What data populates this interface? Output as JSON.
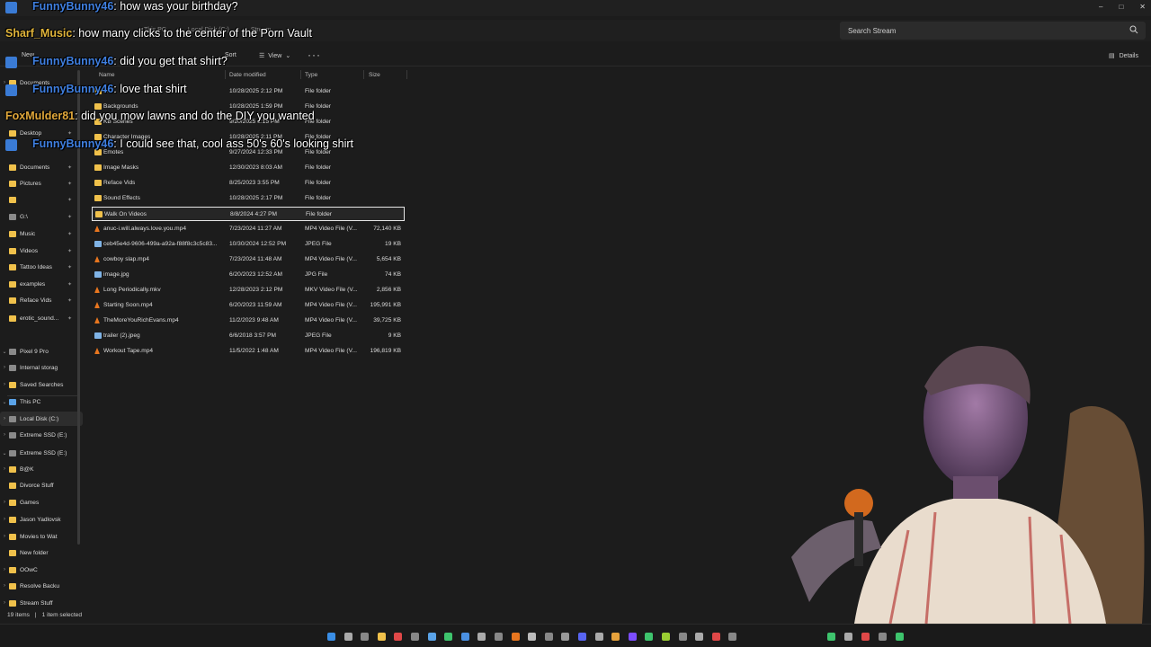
{
  "window": {
    "controls": [
      "–",
      "□",
      "✕"
    ]
  },
  "address": {
    "crumbs": [
      "This PC",
      "Local Disk (C:)",
      "Stream"
    ]
  },
  "search": {
    "placeholder": "Search Stream"
  },
  "toolbar": {
    "new_label": "New",
    "sort_label": "Sort",
    "view_label": "View",
    "more_label": "···",
    "details_label": "Details"
  },
  "columns": {
    "name": "Name",
    "date": "Date modified",
    "type": "Type",
    "size": "Size"
  },
  "files": [
    {
      "name": "...",
      "date": "10/28/2025 2:12 PM",
      "type": "File folder",
      "size": "",
      "kind": "folder"
    },
    {
      "name": "Backgrounds",
      "date": "10/28/2025 1:59 PM",
      "type": "File folder",
      "size": "",
      "kind": "folder"
    },
    {
      "name": "KB Scenes",
      "date": "9/20/2025 1:15 PM",
      "type": "File folder",
      "size": "",
      "kind": "folder"
    },
    {
      "name": "Character Images",
      "date": "10/28/2025 2:11 PM",
      "type": "File folder",
      "size": "",
      "kind": "folder"
    },
    {
      "name": "Emotes",
      "date": "9/27/2024 12:33 PM",
      "type": "File folder",
      "size": "",
      "kind": "folder"
    },
    {
      "name": "Image Masks",
      "date": "12/30/2023 8:03 AM",
      "type": "File folder",
      "size": "",
      "kind": "folder"
    },
    {
      "name": "Reface Vids",
      "date": "8/25/2023 3:55 PM",
      "type": "File folder",
      "size": "",
      "kind": "folder"
    },
    {
      "name": "Sound Effects",
      "date": "10/28/2025 2:17 PM",
      "type": "File folder",
      "size": "",
      "kind": "folder"
    },
    {
      "name": "Walk On Videos",
      "date": "8/8/2024 4:27 PM",
      "type": "File folder",
      "size": "",
      "kind": "folder"
    },
    {
      "name": "anuc-i.will.always.love.you.mp4",
      "date": "7/23/2024 11:27 AM",
      "type": "MP4 Video File (V...",
      "size": "72,140 KB",
      "kind": "video"
    },
    {
      "name": "ceb45e4d-9606-499a-a92a-f88f8c3c5c83...",
      "date": "10/30/2024 12:52 PM",
      "type": "JPEG File",
      "size": "19 KB",
      "kind": "image"
    },
    {
      "name": "cowboy slap.mp4",
      "date": "7/23/2024 11:48 AM",
      "type": "MP4 Video File (V...",
      "size": "5,654 KB",
      "kind": "video"
    },
    {
      "name": "image.jpg",
      "date": "6/20/2023 12:52 AM",
      "type": "JPG File",
      "size": "74 KB",
      "kind": "image"
    },
    {
      "name": "Long Periodically.mkv",
      "date": "12/28/2023 2:12 PM",
      "type": "MKV Video File (V...",
      "size": "2,856 KB",
      "kind": "video"
    },
    {
      "name": "Starting Soon.mp4",
      "date": "6/20/2023 11:59 AM",
      "type": "MP4 Video File (V...",
      "size": "195,991 KB",
      "kind": "video"
    },
    {
      "name": "TheMoreYouRichEvans.mp4",
      "date": "11/2/2023 9:48 AM",
      "type": "MP4 Video File (V...",
      "size": "39,725 KB",
      "kind": "video"
    },
    {
      "name": "trailer (2).jpeg",
      "date": "6/6/2018 3:57 PM",
      "type": "JPEG File",
      "size": "9 KB",
      "kind": "image"
    },
    {
      "name": "Workout Tape.mp4",
      "date": "11/5/2022 1:48 AM",
      "type": "MP4 Video File (V...",
      "size": "196,819 KB",
      "kind": "video"
    }
  ],
  "nav": [
    {
      "label": "Documents",
      "icon": "folder",
      "pinned": false,
      "chev": "›"
    },
    {
      "label": "Desktop",
      "icon": "folder",
      "pinned": true,
      "chev": ""
    },
    {
      "label": "Documents",
      "icon": "folder",
      "pinned": true,
      "chev": ""
    },
    {
      "label": "Pictures",
      "icon": "folder",
      "pinned": true,
      "chev": ""
    },
    {
      "label": "",
      "icon": "folder",
      "pinned": true,
      "chev": ""
    },
    {
      "label": "G:\\",
      "icon": "drive",
      "pinned": true,
      "chev": ""
    },
    {
      "label": "Music",
      "icon": "folder",
      "pinned": true,
      "chev": ""
    },
    {
      "label": "Videos",
      "icon": "folder",
      "pinned": true,
      "chev": ""
    },
    {
      "label": "Tattoo Ideas",
      "icon": "folder",
      "pinned": true,
      "chev": ""
    },
    {
      "label": "examples",
      "icon": "folder",
      "pinned": true,
      "chev": ""
    },
    {
      "label": "Reface Vids",
      "icon": "folder",
      "pinned": true,
      "chev": ""
    },
    {
      "label": "erotic_sound...",
      "icon": "folder",
      "pinned": true,
      "chev": ""
    },
    {
      "label": "Pixel 9 Pro",
      "icon": "drive",
      "pinned": false,
      "chev": "⌄"
    },
    {
      "label": "Internal storag",
      "icon": "drive",
      "pinned": false,
      "chev": "›"
    },
    {
      "label": "Saved Searches",
      "icon": "folder",
      "pinned": false,
      "chev": "›"
    },
    {
      "label": "This PC",
      "icon": "pc",
      "pinned": false,
      "chev": "⌄"
    },
    {
      "label": "Local Disk (C:)",
      "icon": "drive",
      "pinned": false,
      "chev": "›"
    },
    {
      "label": "Extreme SSD (E:)",
      "icon": "drive",
      "pinned": false,
      "chev": "›"
    },
    {
      "label": "Extreme SSD (E:)",
      "icon": "drive",
      "pinned": false,
      "chev": "⌄"
    },
    {
      "label": "B@K",
      "icon": "folder",
      "pinned": false,
      "chev": "›"
    },
    {
      "label": "Divorce Stuff",
      "icon": "folder",
      "pinned": false,
      "chev": ""
    },
    {
      "label": "Games",
      "icon": "folder",
      "pinned": false,
      "chev": "›"
    },
    {
      "label": "Jason Yadlovsk",
      "icon": "folder",
      "pinned": false,
      "chev": "›"
    },
    {
      "label": "Movies to Wat",
      "icon": "folder",
      "pinned": false,
      "chev": "›"
    },
    {
      "label": "New folder",
      "icon": "folder",
      "pinned": false,
      "chev": ""
    },
    {
      "label": "OOwC",
      "icon": "folder",
      "pinned": false,
      "chev": "›"
    },
    {
      "label": "Resolve Backu",
      "icon": "folder",
      "pinned": false,
      "chev": "›"
    },
    {
      "label": "Stream Stuff",
      "icon": "folder",
      "pinned": false,
      "chev": "›"
    }
  ],
  "status": {
    "count": "19 items",
    "selected": "1 item selected"
  },
  "chat": [
    {
      "user": "FunnyBunny46",
      "message": "how was your birthday?",
      "color": "#3f7fe0",
      "icon": "twitch-icon"
    },
    {
      "user": "Sharf_Music",
      "message": "how many clicks to the center of the Porn Vault",
      "color": "#e0b43a",
      "icon": ""
    },
    {
      "user": "FunnyBunny46",
      "message": "did you get that shirt?",
      "color": "#3f7fe0",
      "icon": "twitch-icon"
    },
    {
      "user": "FunnyBunny46",
      "message": "love that shirt",
      "color": "#3f7fe0",
      "icon": "twitch-icon"
    },
    {
      "user": "FoxMulder81",
      "message": "did you mow lawns and do the DIY you wanted",
      "color": "#e0a73a",
      "icon": ""
    },
    {
      "user": "FunnyBunny46",
      "message": "I could see that, cool ass 50's 60's looking shirt",
      "color": "#3f7fe0",
      "icon": "twitch-icon"
    }
  ],
  "colors": {
    "accent": "#3f7fe0",
    "folder": "#f0c14b",
    "video": "#e8761f"
  }
}
